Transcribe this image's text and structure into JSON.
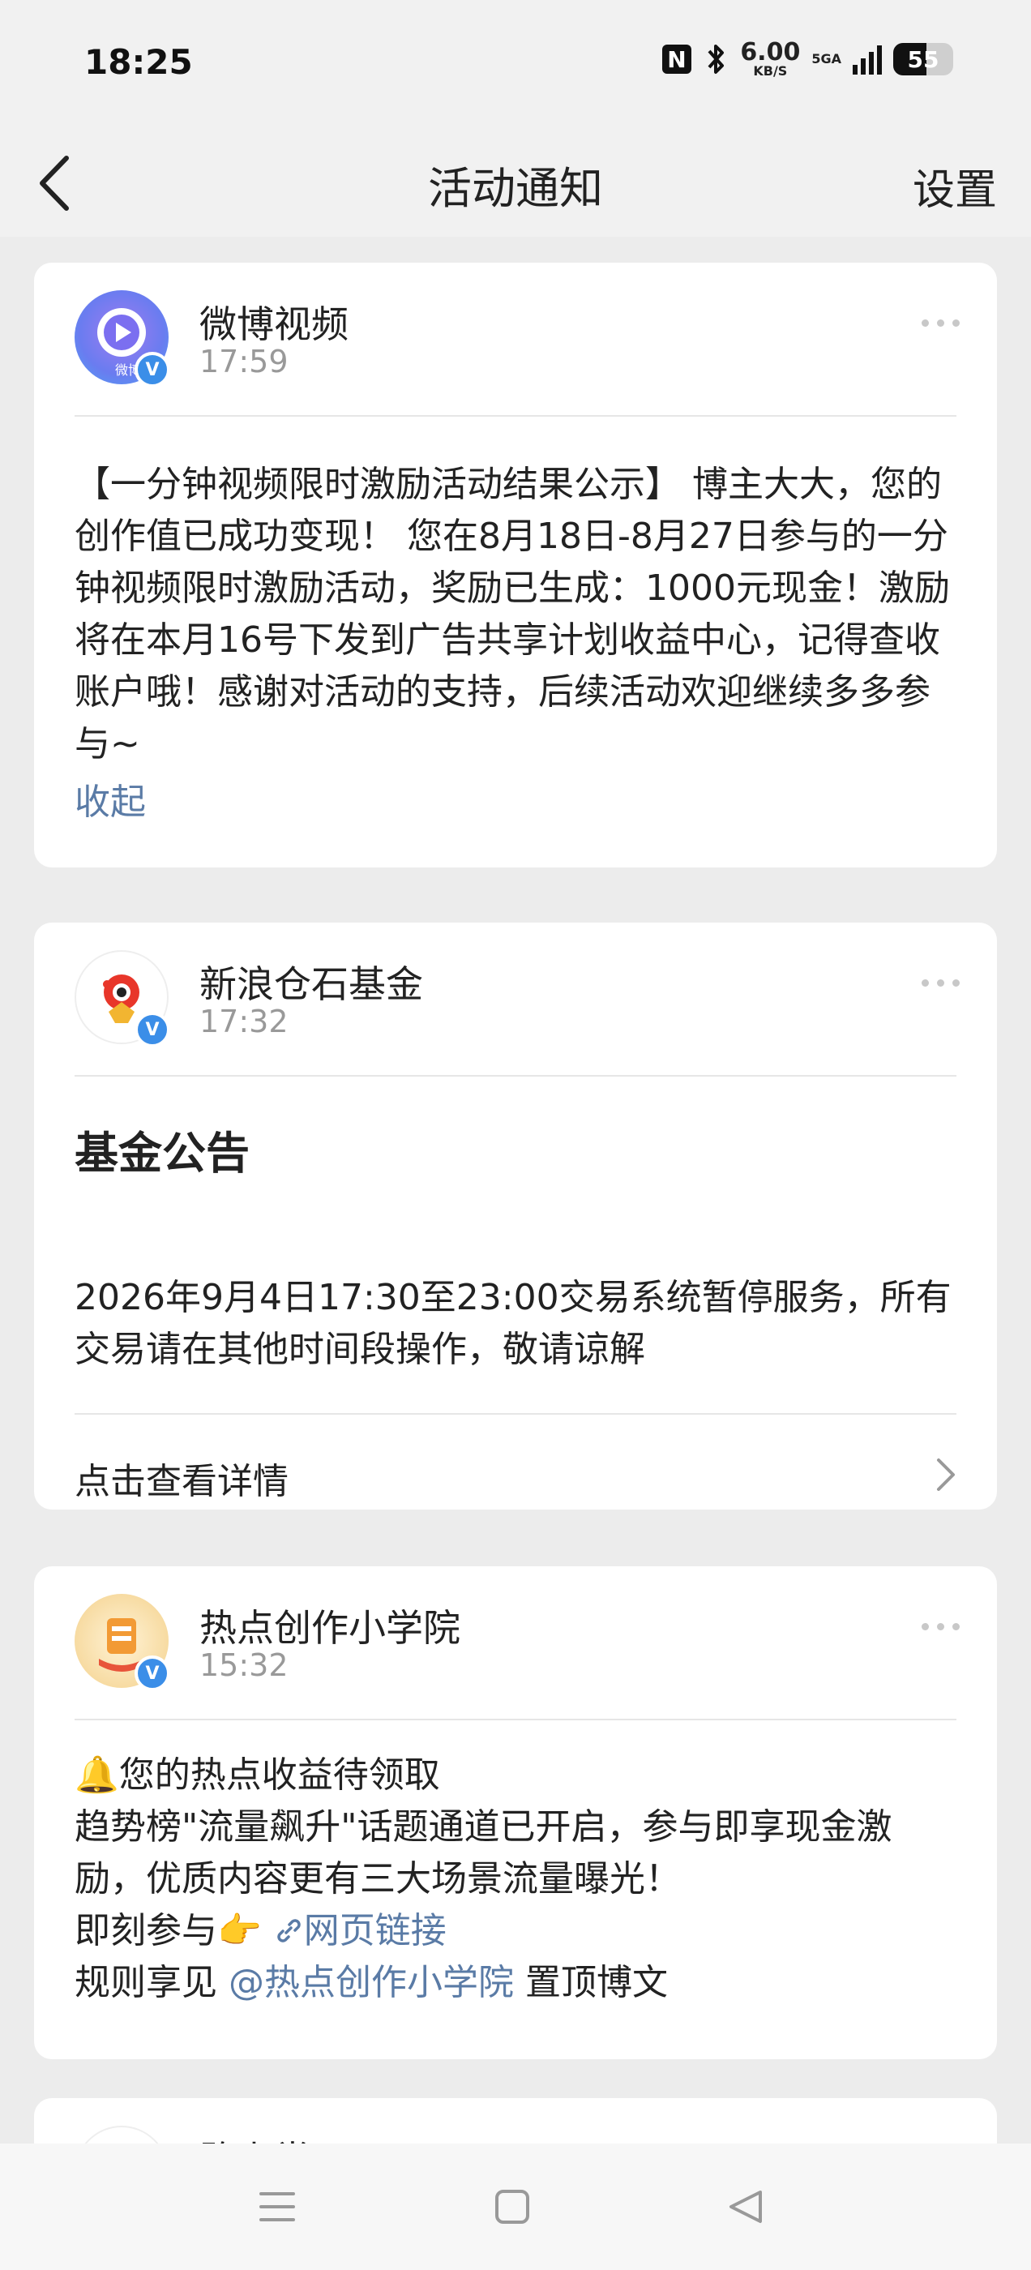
{
  "status_bar": {
    "time": "18:25",
    "nfc_icon": "N",
    "net_speed": "6.00",
    "net_unit": "KB/S",
    "net_type": "5GA",
    "battery": "55",
    "battery_level": 55
  },
  "nav": {
    "back_icon": "chevron-left-icon",
    "title": "活动通知",
    "settings": "设置"
  },
  "cards": [
    {
      "sender": "微博视频",
      "time": "17:59",
      "badge": "V",
      "avatar_text": "微博视",
      "body": "【一分钟视频限时激励活动结果公示】 博主大大，您的创作值已成功变现！ 您在8月18日-8月27日参与的一分钟视频限时激励活动，奖励已生成：1000元现金！激励将在本月16号下发到广告共享计划收益中心，记得查收账户哦！感谢对活动的支持，后续活动欢迎继续多多参与~",
      "collapse": "收起"
    },
    {
      "sender": "新浪仓石基金",
      "time": "17:32",
      "badge": "V",
      "title": "基金公告",
      "body": "2026年9月4日17:30至23:00交易系统暂停服务，所有交易请在其他时间段操作，敬请谅解",
      "detail": "点击查看详情"
    },
    {
      "sender": "热点创作小学院",
      "time": "15:32",
      "badge": "V",
      "line1_emoji": "🔔",
      "line1": "您的热点收益待领取",
      "line2": "趋势榜\"流量飙升\"话题通道已开启，参与即享现金激励，优质内容更有三大场景流量曝光！",
      "line3_prefix": "即刻参与",
      "line3_emoji": "👉",
      "link_text": "网页链接",
      "line4_prefix": "规则享见 ",
      "mention": "@热点创作小学院",
      "line4_suffix": " 置顶博文"
    },
    {
      "sender": "路上党"
    }
  ],
  "bottom_nav": {
    "menu_icon": "menu-icon",
    "home_icon": "home-square-icon",
    "back_icon": "back-triangle-icon"
  }
}
